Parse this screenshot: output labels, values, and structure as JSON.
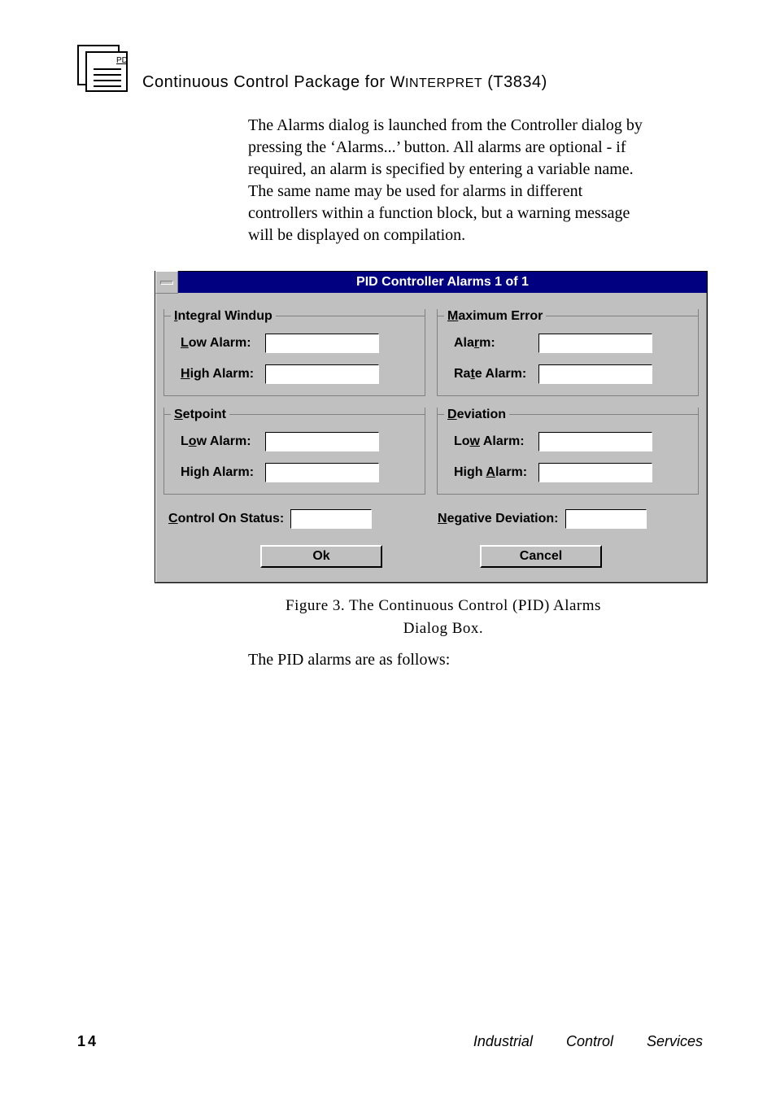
{
  "header": {
    "title_pre": "Continuous Control Package for ",
    "title_app": "Winterpret",
    "title_code": " (T3834)"
  },
  "para1": "The Alarms dialog is launched from the Controller dialog by pressing the ‘Alarms...’ button.  All alarms are optional - if required, an alarm is specified by entering a variable name.  The same name may be used for alarms in different controllers within a function block, but a warning message will be displayed on compilation.",
  "dialog": {
    "title": "PID Controller Alarms 1 of 1",
    "groups": {
      "integral": {
        "legend_pre": "I",
        "legend_rest": "ntegral Windup",
        "low_pre": "L",
        "low_rest": "ow Alarm:",
        "high_pre": "H",
        "high_rest": "igh Alarm:",
        "low_val": "",
        "high_val": ""
      },
      "max": {
        "legend_pre": "M",
        "legend_rest": "aximum Error",
        "alarm_pre": "Ala",
        "alarm_u": "r",
        "alarm_rest": "m:",
        "rate_pre": "Ra",
        "rate_u": "t",
        "rate_rest": "e Alarm:",
        "alarm_val": "",
        "rate_val": ""
      },
      "setpoint": {
        "legend_pre": "S",
        "legend_rest": "etpoint",
        "low_pre": "L",
        "low_u": "o",
        "low_rest": "w Alarm:",
        "high": "High Alarm:",
        "low_val": "",
        "high_val": ""
      },
      "deviation": {
        "legend_pre": "D",
        "legend_rest": "eviation",
        "low_pre": "Lo",
        "low_u": "w",
        "low_rest": " Alarm:",
        "high_pre": "High ",
        "high_u": "A",
        "high_rest": "larm:",
        "low_val": "",
        "high_val": ""
      }
    },
    "control_on_pre": "C",
    "control_on_rest": "ontrol On Status:",
    "control_on_val": "",
    "negdev_pre": "N",
    "negdev_rest": "egative Deviation:",
    "negdev_val": "",
    "ok": "Ok",
    "cancel": "Cancel"
  },
  "caption_pre": "Figure 3.   The Continuous Control (PID) Alarms",
  "caption_line2": "Dialog Box.",
  "para2": "The PID alarms are as follows:",
  "footer": {
    "page": "14",
    "svc": "Industrial Control Services"
  }
}
